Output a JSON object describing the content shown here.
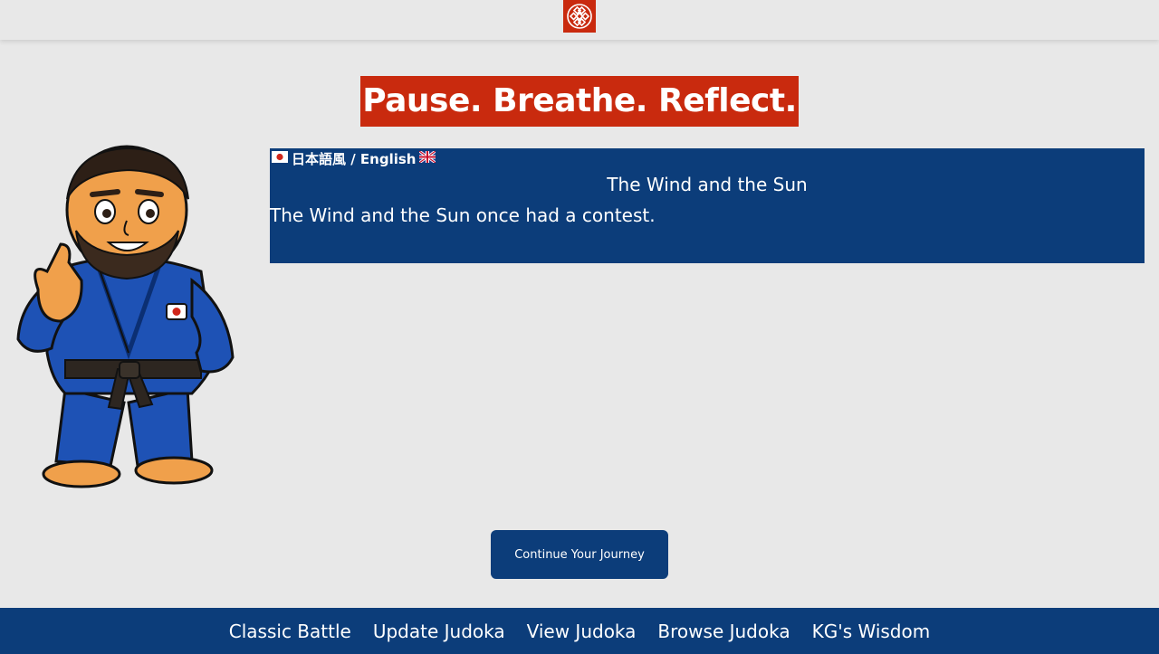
{
  "header": {
    "logo_icon": "knot-logo-icon"
  },
  "hero": {
    "title": "Pause. Breathe. Reflect."
  },
  "mascot": {
    "icon": "judoka-mascot-illustration"
  },
  "story": {
    "language_toggle_label": "日本語風 / English",
    "flag_left": "japan-flag-icon",
    "flag_right": "uk-flag-icon",
    "title": "The Wind and the Sun",
    "body": "The Wind and the Sun once had a contest."
  },
  "actions": {
    "continue_label": "Continue Your Journey"
  },
  "footer": {
    "links": [
      {
        "label": "Classic Battle"
      },
      {
        "label": "Update Judoka"
      },
      {
        "label": "View Judoka"
      },
      {
        "label": "Browse Judoka"
      },
      {
        "label": "KG's Wisdom"
      }
    ]
  },
  "colors": {
    "brand_red": "#c92a0e",
    "brand_blue": "#0c3d7a",
    "background": "#e8e8e8"
  }
}
